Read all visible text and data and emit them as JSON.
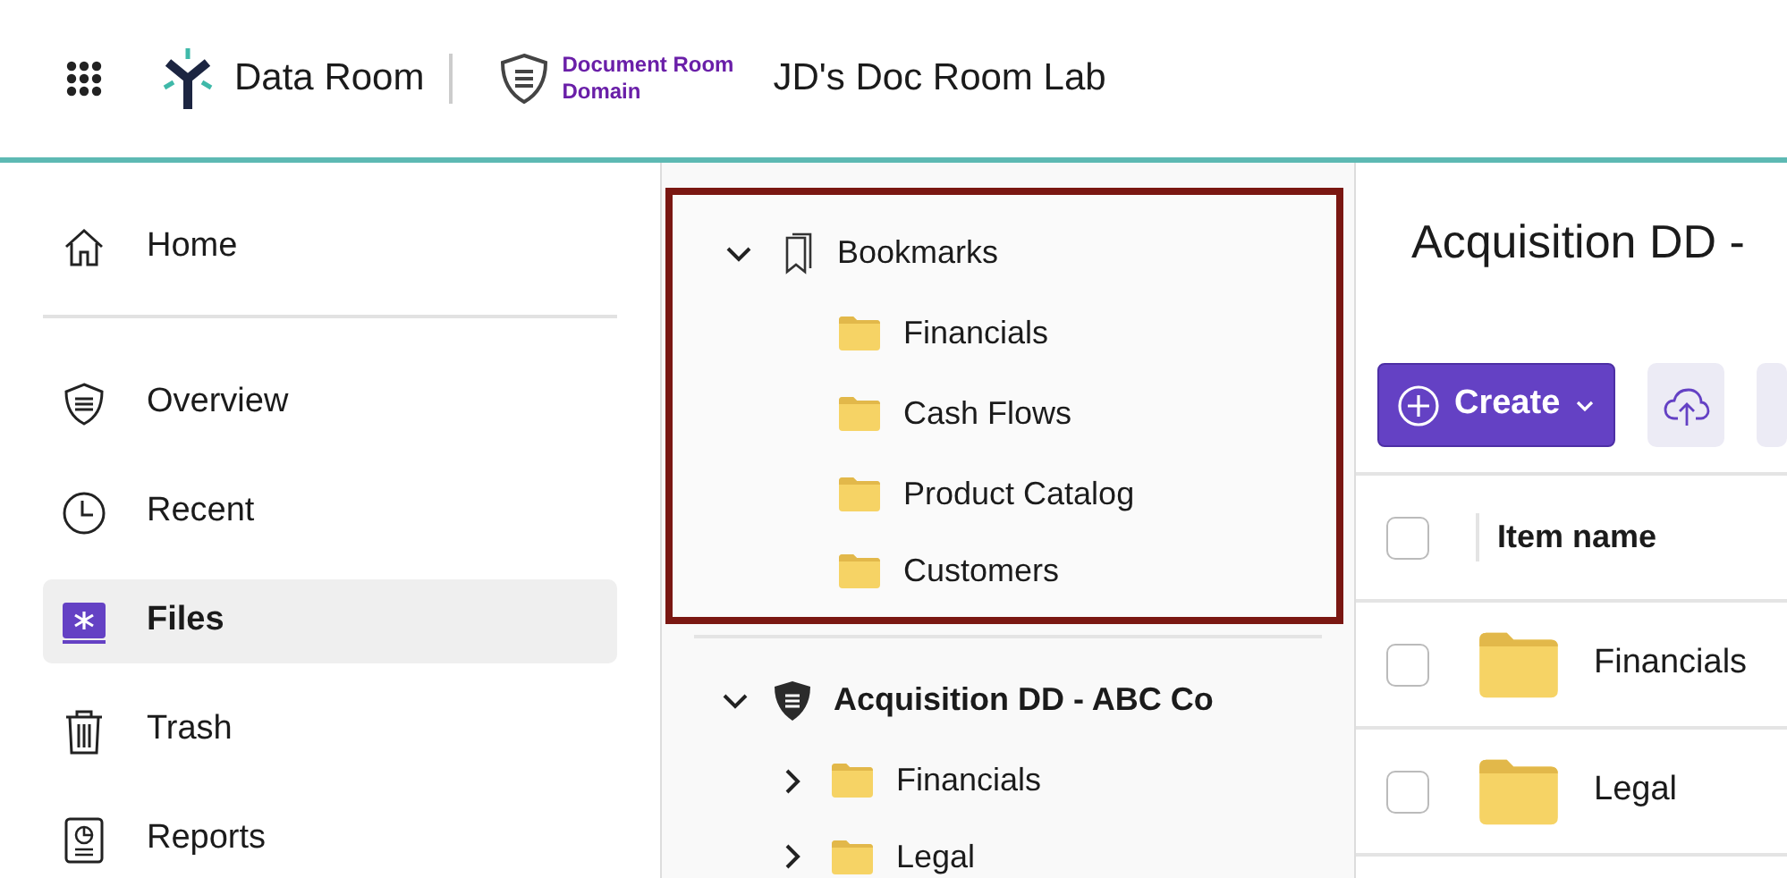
{
  "header": {
    "app_name": "Data Room",
    "domain_label": "Document Room Domain",
    "room_name": "JD's Doc Room Lab"
  },
  "sidebar": {
    "items": [
      {
        "label": "Home",
        "selected": false
      },
      {
        "label": "Overview",
        "selected": false
      },
      {
        "label": "Recent",
        "selected": false
      },
      {
        "label": "Files",
        "selected": true
      },
      {
        "label": "Trash",
        "selected": false
      },
      {
        "label": "Reports",
        "selected": false
      }
    ]
  },
  "tree": {
    "sections": [
      {
        "label": "Bookmarks",
        "kind": "bookmarks",
        "expanded": true,
        "highlighted": true,
        "children": [
          {
            "label": "Financials"
          },
          {
            "label": "Cash Flows"
          },
          {
            "label": "Product Catalog"
          },
          {
            "label": "Customers"
          }
        ]
      },
      {
        "label": "Acquisition DD - ABC Co",
        "kind": "room",
        "expanded": true,
        "highlighted": false,
        "children": [
          {
            "label": "Financials",
            "expanded": false
          },
          {
            "label": "Legal",
            "expanded": false
          }
        ]
      }
    ]
  },
  "content": {
    "title": "Acquisition DD -",
    "create_button": "Create",
    "table": {
      "header_checked": false,
      "columns": [
        "Item name"
      ],
      "rows": [
        {
          "name": "Financials",
          "checked": false
        },
        {
          "name": "Legal",
          "checked": false
        }
      ]
    }
  }
}
